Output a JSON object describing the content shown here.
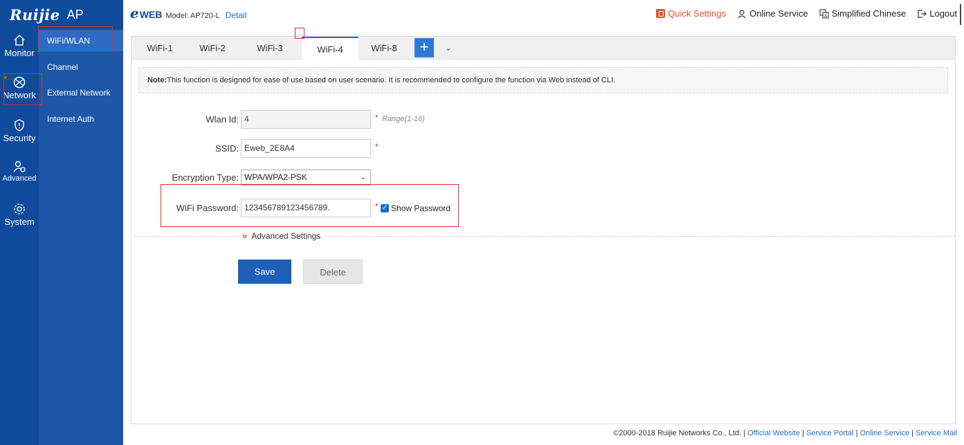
{
  "header": {
    "brand": "Ruijie",
    "product": "AP",
    "eweb_mark": "e",
    "eweb_text": "WEB",
    "model": "Model: AP720-L",
    "detail": "Detail",
    "quick_settings": "Quick Settings",
    "online_service": "Online Service",
    "language": "Simplified Chinese",
    "logout": "Logout"
  },
  "sidebar": {
    "items": [
      {
        "label": "Monitor",
        "icon": "home-icon"
      },
      {
        "label": "Network",
        "icon": "network-globe-icon"
      },
      {
        "label": "Security",
        "icon": "shield-icon"
      },
      {
        "label": "Advanced",
        "icon": "advanced-user-icon"
      },
      {
        "label": "System",
        "icon": "gear-icon"
      }
    ]
  },
  "subnav": {
    "items": [
      {
        "label": "WiFi/WLAN"
      },
      {
        "label": "Channel"
      },
      {
        "label": "External Network"
      },
      {
        "label": "Internet Auth"
      }
    ]
  },
  "tabs": {
    "items": [
      {
        "label": "WiFi-1"
      },
      {
        "label": "WiFi-2"
      },
      {
        "label": "WiFi-3"
      },
      {
        "label": "WiFi-4"
      },
      {
        "label": "WiFi-8"
      }
    ],
    "add": "+",
    "more": "⌄"
  },
  "note": {
    "prefix": "Note:",
    "text": "This function is designed for ease of use based on user scenario. It is recommended to configure the function via Web instead of CLI."
  },
  "form": {
    "wlan_id": {
      "label": "Wlan Id:",
      "value": "4",
      "range": "Range(1-16)"
    },
    "ssid": {
      "label": "SSID:",
      "value": "Eweb_2E8A4"
    },
    "encryption": {
      "label": "Encryption Type:",
      "value": "WPA/WPA2-PSK"
    },
    "password": {
      "label": "WiFi Password:",
      "value": "123456789123456789.",
      "show_password": "Show Password",
      "show_checked": true
    },
    "required_mark": "*",
    "advanced": "Advanced Settings",
    "advanced_arrow": "»"
  },
  "buttons": {
    "save": "Save",
    "delete": "Delete"
  },
  "footer": {
    "copyright": "©2000-2018 Ruijie Networks Co., Ltd. |",
    "official": "Official Website",
    "portal": "Service Portal",
    "online": "Online Service",
    "mail": "Service Mail",
    "sep": "|"
  },
  "colors": {
    "sidebar": "#0f4a9c",
    "subnav": "#1e56a8",
    "accent": "#1a6fc9",
    "quick": "#e8512a",
    "annotation": "#e52b2b"
  }
}
